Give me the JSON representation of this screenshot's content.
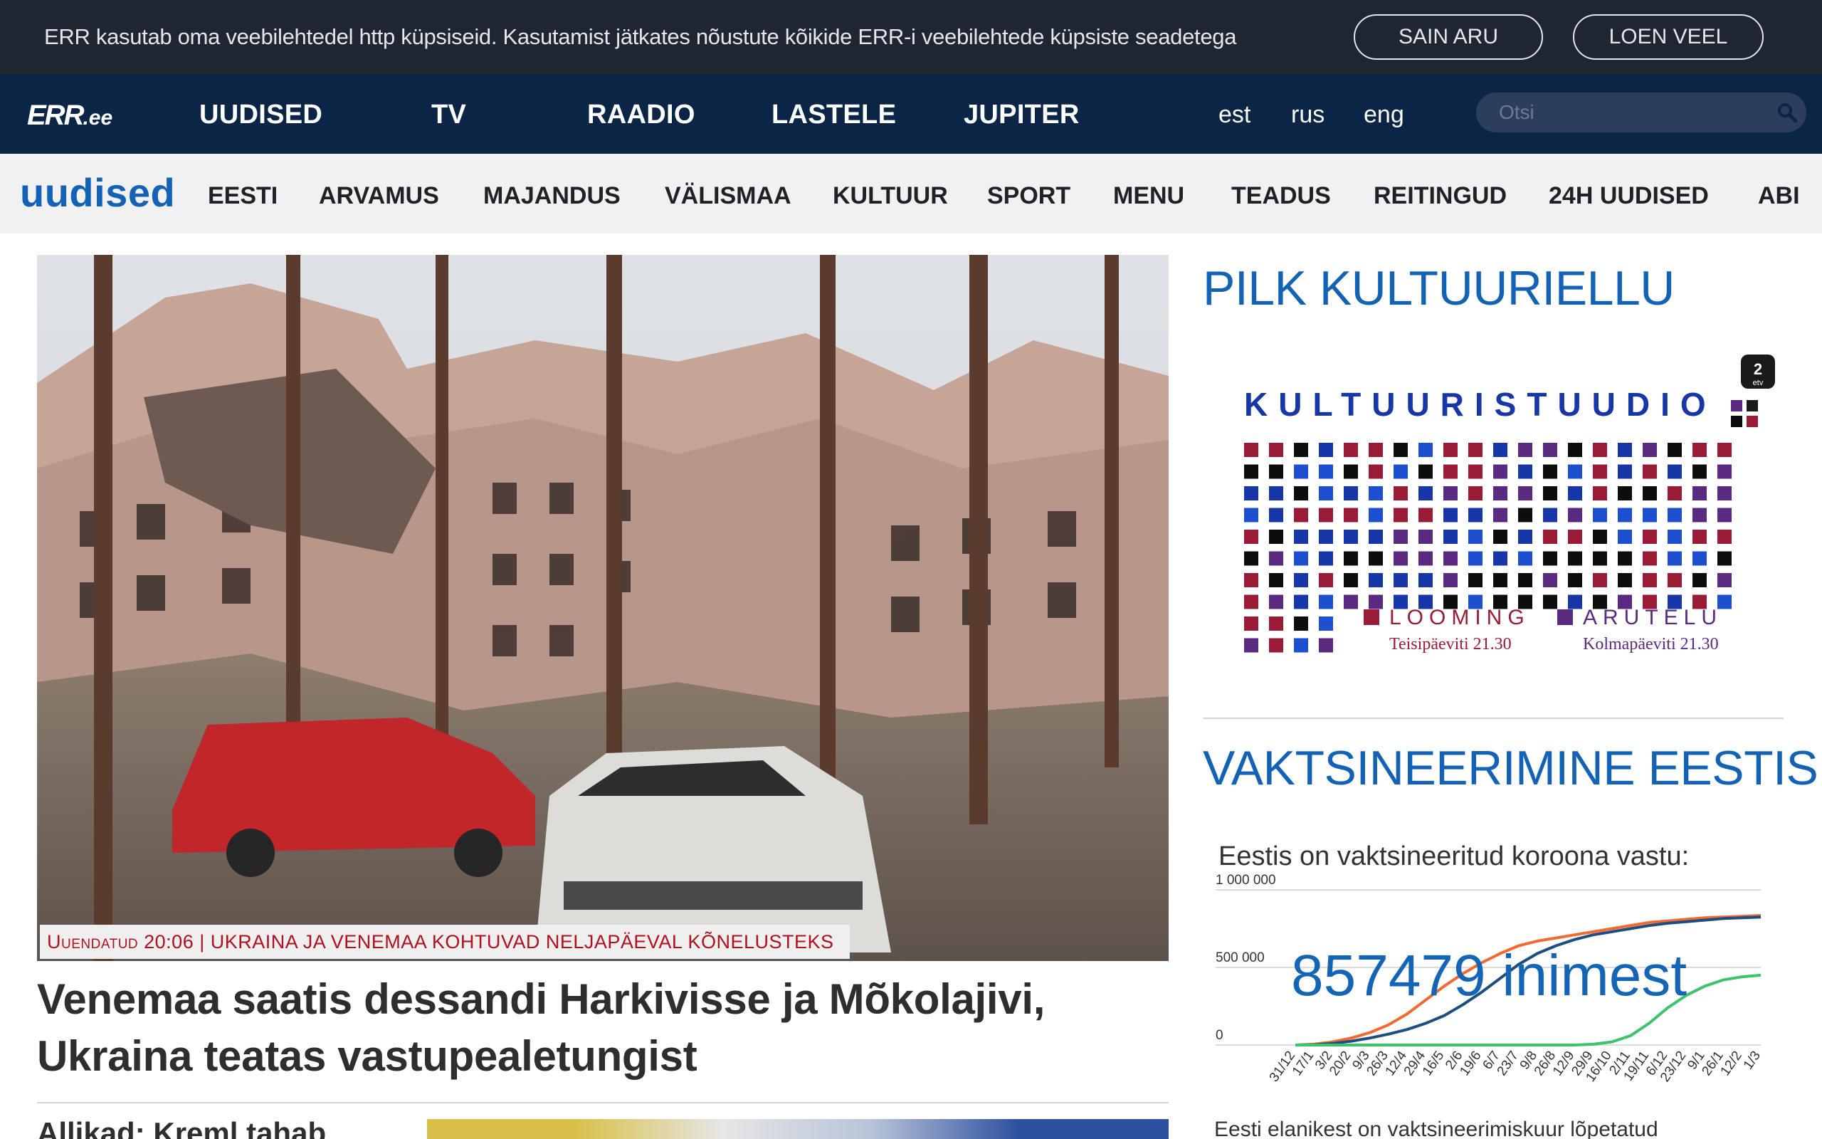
{
  "cookie_bar": {
    "text": "ERR kasutab oma veebilehtedel http küpsiseid. Kasutamist jätkates nõustute kõikide ERR-i veebilehtede küpsiste seadetega",
    "agree_label": "SAIN ARU",
    "more_label": "LOEN VEEL"
  },
  "header": {
    "logo_main": "ERR",
    "logo_suffix": ".ee",
    "nav": [
      "UUDISED",
      "TV",
      "RAADIO",
      "LASTELE",
      "JUPITER"
    ],
    "languages": [
      "est",
      "rus",
      "eng"
    ],
    "search_placeholder": "Otsi"
  },
  "section_nav": {
    "title": "uudised",
    "items": [
      "EESTI",
      "ARVAMUS",
      "MAJANDUS",
      "VÄLISMAA",
      "KULTUUR",
      "SPORT",
      "MENU",
      "TEADUS",
      "REITINGUD",
      "24H UUDISED",
      "ABI"
    ]
  },
  "main_story": {
    "caption": "Uuendatud 20:06 | UKRAINA JA VENEMAA KOHTUVAD NELJAPÄEVAL KÕNELUSTEKS",
    "headline_line1": "Venemaa saatis dessandi Harkivisse ja Mõkolajivi,",
    "headline_line2": "Ukraina teatas vastupealetungist",
    "sub_headline": "Allikad: Kreml tahab"
  },
  "sidebar": {
    "banner_title": "PILK KULTUURIELLU",
    "banner": {
      "badge": "2 etv",
      "title": "KULTUURISTUUDIO",
      "show1_name": "LOOMING",
      "show1_time": "Teisipäeviti 21.30",
      "show2_name": "ARUTELU",
      "show2_time": "Kolmapäeviti 21.30"
    },
    "vacc_title": "VAKTSINEERIMINE EESTIS",
    "vacc_heading": "Eestis on vaktsineeritud koroona vastu:",
    "vacc_count": "857479 inimest",
    "vacc_footer": "Eesti elanikest on vaktsineerimiskuur lõpetatud"
  },
  "colors": {
    "nav_bg": "#0b2546",
    "cookie_bg": "#1f2531",
    "accent_blue": "#1462b5",
    "caption_red": "#b2101c",
    "series_orange": "#f26a32",
    "series_navy": "#1c4e80",
    "series_green": "#3cc46a"
  },
  "chart_data": {
    "type": "line",
    "title": "Eestis on vaktsineeritud koroona vastu:",
    "x": [
      "31/12",
      "17/1",
      "3/2",
      "20/2",
      "9/3",
      "26/3",
      "12/4",
      "29/4",
      "16/5",
      "2/6",
      "19/6",
      "6/7",
      "23/7",
      "9/8",
      "26/8",
      "12/9",
      "29/9",
      "16/10",
      "2/11",
      "19/11",
      "6/12",
      "23/12",
      "9/1",
      "26/1",
      "12/2",
      "1/3"
    ],
    "yticks": [
      "1 000 000",
      "500 000",
      "0"
    ],
    "ylim": [
      0,
      1000000
    ],
    "series": [
      {
        "values": [
          0,
          5000,
          20000,
          45000,
          80000,
          130000,
          200000,
          290000,
          380000,
          460000,
          530000,
          590000,
          640000,
          670000,
          690000,
          710000,
          730000,
          750000,
          770000,
          790000,
          800000,
          810000,
          820000,
          825000,
          830000,
          835000
        ]
      },
      {
        "values": [
          0,
          2000,
          10000,
          25000,
          45000,
          70000,
          100000,
          140000,
          190000,
          260000,
          340000,
          430000,
          520000,
          590000,
          640000,
          680000,
          710000,
          730000,
          750000,
          770000,
          785000,
          795000,
          805000,
          815000,
          820000,
          825000
        ]
      },
      {
        "values": [
          0,
          0,
          0,
          0,
          0,
          0,
          0,
          0,
          0,
          0,
          0,
          0,
          0,
          0,
          0,
          0,
          5000,
          20000,
          60000,
          140000,
          240000,
          320000,
          380000,
          420000,
          440000,
          450000
        ]
      }
    ]
  }
}
